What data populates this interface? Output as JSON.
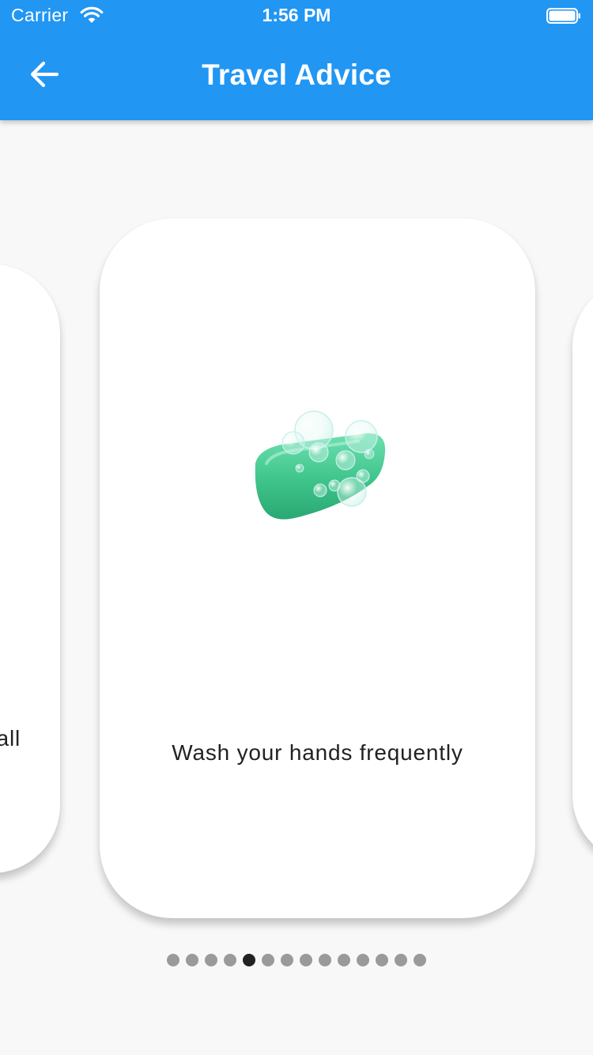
{
  "status_bar": {
    "carrier": "Carrier",
    "time": "1:56 PM",
    "wifi_icon": "wifi-icon",
    "battery_icon": "battery-icon"
  },
  "app_bar": {
    "title": "Travel Advice",
    "back_icon": "arrow-left-icon",
    "color": "#2196f3"
  },
  "carousel": {
    "previous_card_text": "all",
    "current_card": {
      "icon": "soap-icon",
      "caption": "Wash your hands frequently"
    }
  },
  "pagination": {
    "total": 14,
    "current_index": 4,
    "active_color": "#222222",
    "inactive_color": "#9a9a9a"
  }
}
